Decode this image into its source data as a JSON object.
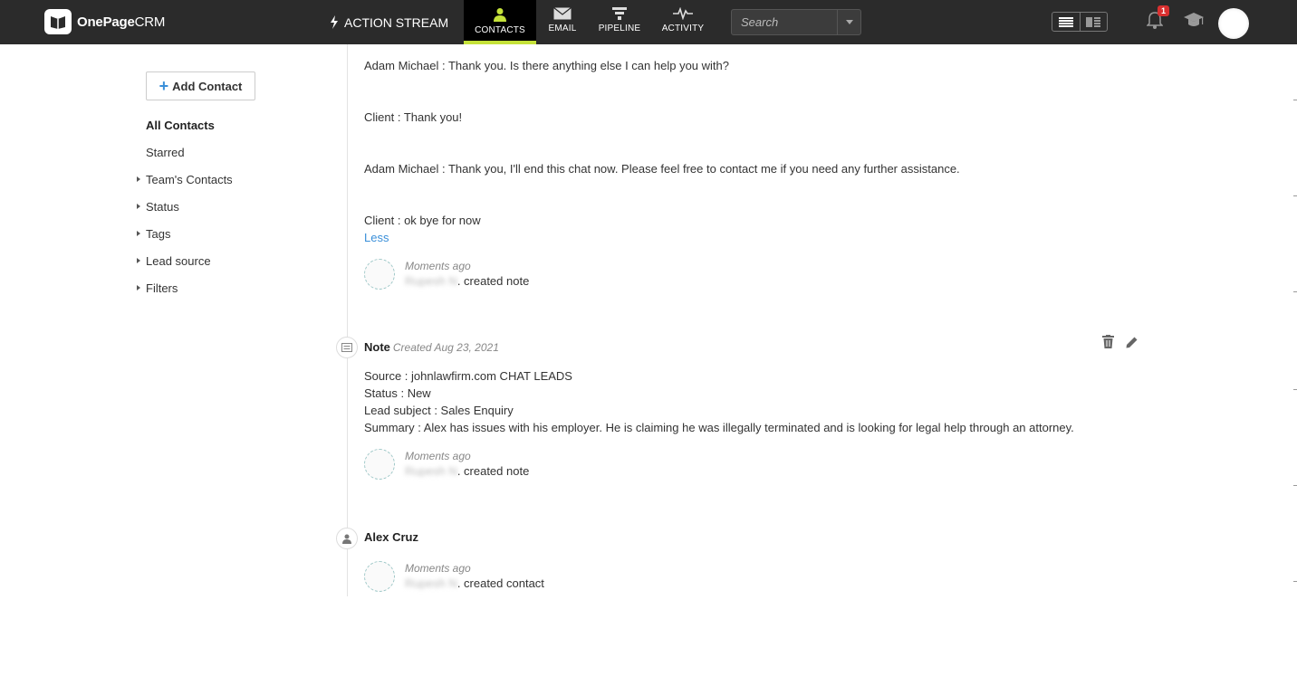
{
  "app": {
    "logo_name": "OnePage",
    "logo_suffix": "CRM"
  },
  "nav": {
    "action_stream": "ACTION STREAM",
    "tabs": [
      {
        "label": "CONTACTS",
        "icon": "person-icon",
        "active": true
      },
      {
        "label": "EMAIL",
        "icon": "envelope-icon",
        "active": false
      },
      {
        "label": "PIPELINE",
        "icon": "funnel-icon",
        "active": false
      },
      {
        "label": "ACTIVITY",
        "icon": "pulse-icon",
        "active": false
      }
    ],
    "search_placeholder": "Search",
    "notification_count": "1",
    "accent_color": "#c5e23a"
  },
  "sidebar": {
    "add_contact": "Add Contact",
    "items": [
      {
        "label": "All Contacts",
        "expandable": false,
        "selected": true
      },
      {
        "label": "Starred",
        "expandable": false,
        "selected": false
      },
      {
        "label": "Team's Contacts",
        "expandable": true,
        "selected": false
      },
      {
        "label": "Status",
        "expandable": true,
        "selected": false
      },
      {
        "label": "Tags",
        "expandable": true,
        "selected": false
      },
      {
        "label": "Lead source",
        "expandable": true,
        "selected": false
      },
      {
        "label": "Filters",
        "expandable": true,
        "selected": false
      }
    ]
  },
  "timeline": {
    "chat_lines": [
      "Adam Michael : Thank you. Is there anything else I can help you with?",
      "Client : Thank you!",
      "Adam Michael : Thank you, I'll end this chat now. Please feel free to contact me if you need any further assistance.",
      "Client : ok bye for now"
    ],
    "less_link": "Less",
    "entries": [
      {
        "time": "Moments ago",
        "who_blurred": "Rupesh N",
        "action": ". created note"
      },
      {
        "time": "Moments ago",
        "who_blurred": "Rupesh N",
        "action": ". created note"
      },
      {
        "time": "Moments ago",
        "who_blurred": "Rupesh N",
        "action": ". created contact"
      }
    ],
    "note": {
      "title": "Note",
      "created": "Created Aug 23, 2021",
      "lines": [
        "Source : johnlawfirm.com CHAT LEADS",
        "Status : New",
        "Lead subject : Sales Enquiry",
        "Summary : Alex has issues with his employer. He is claiming he was illegally terminated and is looking for legal help through an attorney."
      ]
    },
    "contact_name": "Alex Cruz"
  }
}
